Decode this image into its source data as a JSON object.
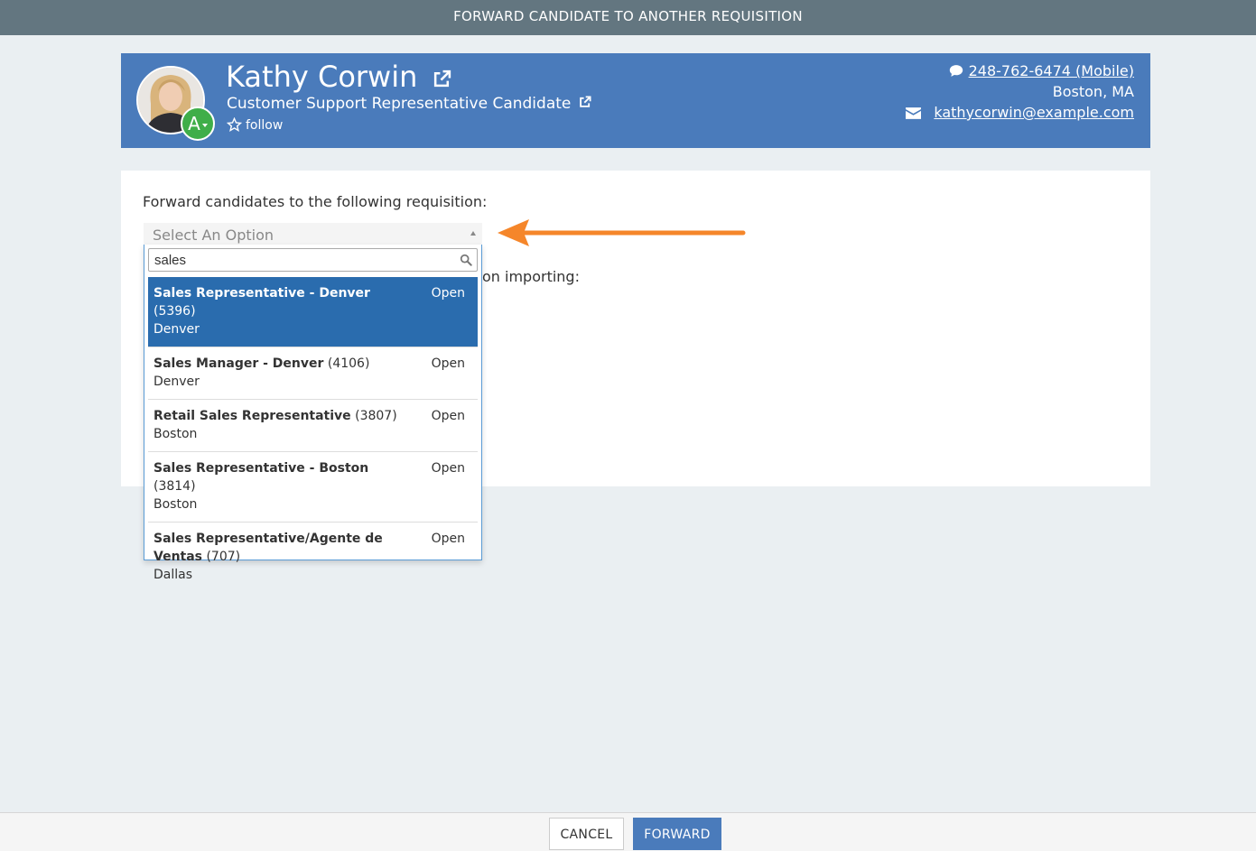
{
  "modal": {
    "title": "FORWARD CANDIDATE TO ANOTHER REQUISITION"
  },
  "candidate": {
    "name": "Kathy Corwin",
    "title": "Customer Support Representative Candidate",
    "grade": "A",
    "follow_label": "follow",
    "phone": "248-762-6474 (Mobile)",
    "location": "Boston, MA",
    "email": "kathycorwin@example.com"
  },
  "form": {
    "requisition_label": "Forward candidates to the following requisition:",
    "import_label": "on importing:",
    "select_placeholder": "Select An Option",
    "search_value": "sales"
  },
  "options": [
    {
      "title": "Sales Representative - Denver",
      "id": "(5396)",
      "location": "Denver",
      "status": "Open",
      "selected": true
    },
    {
      "title": "Sales Manager - Denver",
      "id": "(4106)",
      "location": "Denver",
      "status": "Open"
    },
    {
      "title": "Retail Sales Representative",
      "id": "(3807)",
      "location": "Boston",
      "status": "Open"
    },
    {
      "title": "Sales Representative - Boston",
      "id": "(3814)",
      "location": "Boston",
      "status": "Open"
    },
    {
      "title": "Sales Representative/Agente de Ventas",
      "id": "(707)",
      "location": "Dallas",
      "status": "Open"
    }
  ],
  "footer": {
    "cancel_label": "CANCEL",
    "forward_label": "FORWARD"
  },
  "colors": {
    "header": "#4a7bbb",
    "topbar": "#637680",
    "selected": "#2a6cae",
    "grade": "#3fae49",
    "arrow": "#f5862a"
  }
}
